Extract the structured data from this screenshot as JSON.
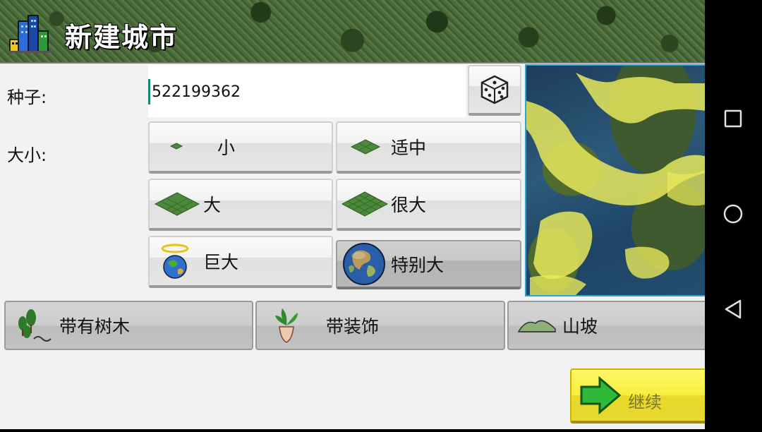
{
  "header": {
    "title": "新建城市",
    "icon": "city-buildings-icon"
  },
  "seed": {
    "label": "种子:",
    "value": "522199362",
    "dice_icon": "dice-icon"
  },
  "size": {
    "label": "大小:",
    "options": [
      {
        "label": "小",
        "icon": "tiny-tile-icon",
        "selected": false
      },
      {
        "label": "适中",
        "icon": "medium-tile-icon",
        "selected": false
      },
      {
        "label": "大",
        "icon": "large-tile-icon",
        "selected": false
      },
      {
        "label": "很大",
        "icon": "very-large-tile-icon",
        "selected": false
      },
      {
        "label": "巨大",
        "icon": "globe-halo-icon",
        "selected": false
      },
      {
        "label": "特别大",
        "icon": "earth-globe-icon",
        "selected": true
      }
    ]
  },
  "options": [
    {
      "label": "带有树木",
      "icon": "trees-icon"
    },
    {
      "label": "带装饰",
      "icon": "potted-plant-icon"
    },
    {
      "label": "山坡",
      "icon": "hills-icon"
    }
  ],
  "continue_label": "继续",
  "colors": {
    "accent_cursor": "#12867a",
    "map_border": "#2fa3d6",
    "continue_yellow": "#f6ee3d"
  }
}
